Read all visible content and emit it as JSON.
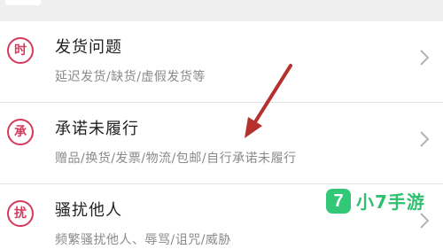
{
  "items": [
    {
      "badge": "时",
      "title": "发货问题",
      "subtitle": "延迟发货/缺货/虚假发货等"
    },
    {
      "badge": "承",
      "title": "承诺未履行",
      "subtitle": "赠品/换货/发票/物流/包邮/自行承诺未履行"
    },
    {
      "badge": "扰",
      "title": "骚扰他人",
      "subtitle": "频繁骚扰他人、辱骂/诅咒/威胁"
    }
  ],
  "watermark": {
    "logo_glyph": "7",
    "text": "小7手游"
  },
  "colors": {
    "badge": "#d63a5c",
    "annotation_arrow": "#b5302f",
    "watermark": "#2fbf6e"
  },
  "icons": {
    "chevron": "chevron-right-icon",
    "arrow": "annotation-arrow"
  }
}
